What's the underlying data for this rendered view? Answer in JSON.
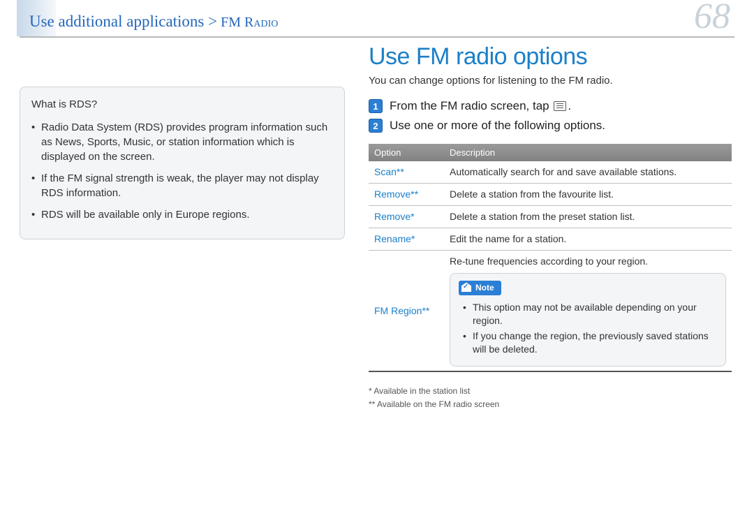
{
  "header": {
    "breadcrumb_main": "Use additional applications ",
    "breadcrumb_sep": ">",
    "breadcrumb_sub": " FM Radio",
    "page_number": "68"
  },
  "rds_box": {
    "title": "What is RDS?",
    "items": [
      "Radio Data System (RDS) provides program information such as News, Sports, Music, or station information which is displayed on the screen.",
      "If the FM signal strength is weak, the player may not display RDS information.",
      "RDS will be available only in Europe regions."
    ]
  },
  "section": {
    "title": "Use FM radio options",
    "subtitle": "You can change options for listening to the FM radio."
  },
  "steps": [
    {
      "num": "1",
      "text_before": "From the FM radio screen, tap ",
      "has_icon": true,
      "text_after": "."
    },
    {
      "num": "2",
      "text_before": "Use one or more of the following options.",
      "has_icon": false,
      "text_after": ""
    }
  ],
  "table": {
    "head": {
      "c1": "Option",
      "c2": "Description"
    },
    "rows": [
      {
        "c1": "Scan**",
        "c2": "Automatically search for and save available stations."
      },
      {
        "c1": "Remove**",
        "c2": "Delete a station from the favourite list."
      },
      {
        "c1": "Remove*",
        "c2": "Delete a station from the preset station list."
      },
      {
        "c1": "Rename*",
        "c2": "Edit the name for a station."
      }
    ],
    "fm_region": {
      "c1": "FM Region**",
      "top": "Re-tune frequencies according to your region.",
      "note_label": "Note",
      "notes": [
        "This option may not be available depending on your region.",
        "If you change the region, the previously saved stations will be deleted."
      ]
    }
  },
  "footnotes": [
    "* Available in the station list",
    "** Available on the FM radio screen"
  ]
}
